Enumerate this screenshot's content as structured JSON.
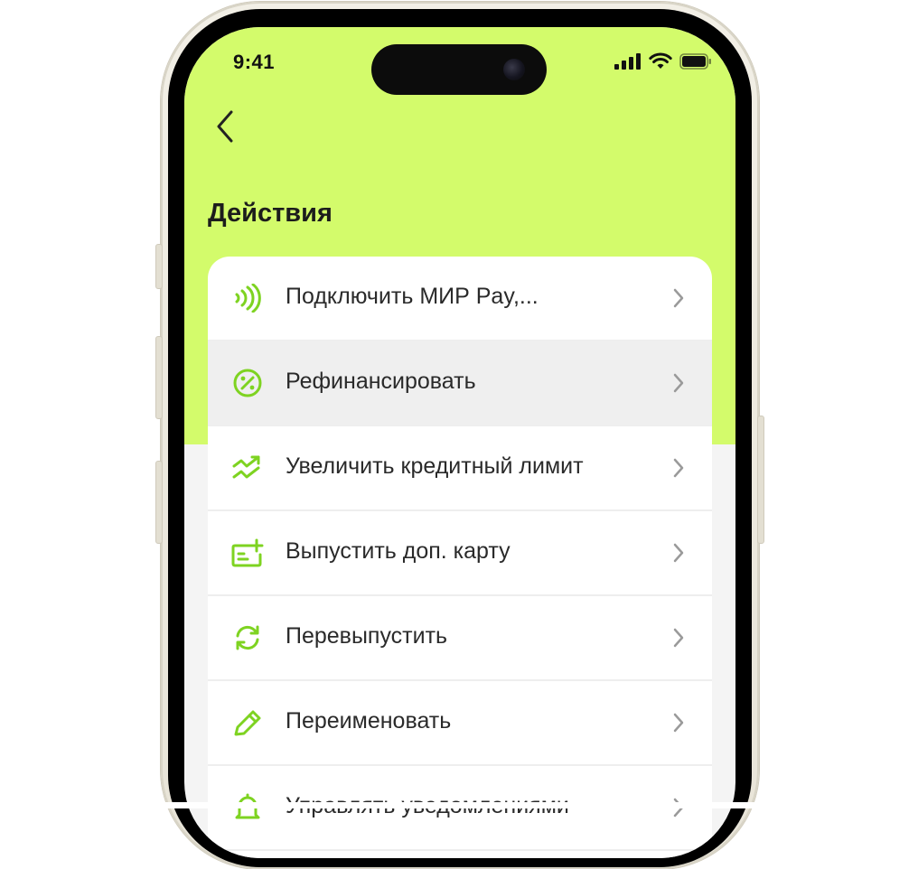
{
  "status_bar": {
    "time": "9:41"
  },
  "header": {
    "title": "Действия"
  },
  "actions": [
    {
      "label": "Подключить МИР Pay,...",
      "icon": "contactless-icon"
    },
    {
      "label": "Рефинансировать",
      "icon": "percent-circle-icon"
    },
    {
      "label": "Увеличить кредитный лимит",
      "icon": "trend-up-icon"
    },
    {
      "label": "Выпустить доп. карту",
      "icon": "card-add-icon"
    },
    {
      "label": "Перевыпустить",
      "icon": "refresh-icon"
    },
    {
      "label": "Переименовать",
      "icon": "pencil-icon"
    },
    {
      "label": "Управлять уведомлениями",
      "icon": "bell-icon"
    }
  ],
  "colors": {
    "accent": "#d3fb6b",
    "icon_green": "#7ed321",
    "active_row": "#efefef"
  }
}
